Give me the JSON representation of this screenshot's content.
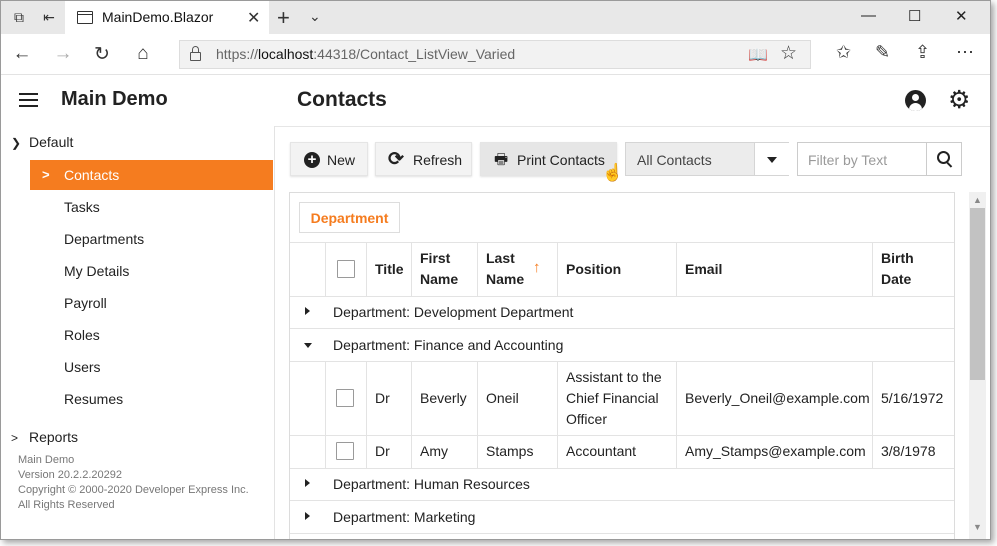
{
  "browser": {
    "tab_title": "MainDemo.Blazor",
    "tab_close": "✕",
    "new_tab": "+",
    "tab_menu": "⌄",
    "url_host_prefix": "https://",
    "url_host": "localhost",
    "url_rest": ":44318/Contact_ListView_Varied",
    "window_controls": {
      "minimize": "—",
      "maximize": "☐",
      "close": "✕"
    },
    "nav": {
      "back": "←",
      "forward": "→",
      "refresh": "↻",
      "home": "⌂"
    },
    "tools": {
      "favorites": "✩",
      "pen": "✎",
      "share": "⇪",
      "more": "⋯"
    }
  },
  "app": {
    "name": "Main Demo",
    "page_title": "Contacts",
    "icons": {
      "user": "user-icon",
      "settings": "gear-icon",
      "settings_glyph": "⚙"
    }
  },
  "sidebar": {
    "group_default": "Default",
    "group_reports": "Reports",
    "items": [
      {
        "label": "Contacts",
        "active": true
      },
      {
        "label": "Tasks"
      },
      {
        "label": "Departments"
      },
      {
        "label": "My Details"
      },
      {
        "label": "Payroll"
      },
      {
        "label": "Roles"
      },
      {
        "label": "Users"
      },
      {
        "label": "Resumes"
      }
    ],
    "footer": {
      "line1": "Main Demo",
      "line2": "Version 20.2.2.20292",
      "line3": "Copyright © 2000-2020 Developer Express Inc.",
      "line4": "All Rights Reserved"
    }
  },
  "toolbar": {
    "new_label": "New",
    "refresh_label": "Refresh",
    "print_label": "Print Contacts",
    "filter_select_value": "All Contacts",
    "search_placeholder": "Filter by Text"
  },
  "grid": {
    "group_tag": "Department",
    "columns": {
      "title": "Title",
      "first_name_1": "First",
      "first_name_2": "Name",
      "last_name_1": "Last",
      "last_name_2": "Name",
      "position": "Position",
      "email": "Email",
      "birth_1": "Birth",
      "birth_2": "Date"
    },
    "sort_indicator": "↑",
    "groups": [
      {
        "label": "Department: Development Department",
        "expanded": false
      },
      {
        "label": "Department: Finance and Accounting",
        "expanded": true
      },
      {
        "label": "Department: Human Resources",
        "expanded": false
      },
      {
        "label": "Department: Marketing",
        "expanded": false
      }
    ],
    "rows": [
      {
        "title": "Dr",
        "first": "Beverly",
        "last": "Oneil",
        "position_1": "Assistant to the",
        "position_2": "Chief Financial",
        "position_3": "Officer",
        "email": "Beverly_Oneil@example.com",
        "birth": "5/16/1972"
      },
      {
        "title": "Dr",
        "first": "Amy",
        "last": "Stamps",
        "position_1": "Accountant",
        "email": "Amy_Stamps@example.com",
        "birth": "3/8/1978"
      }
    ]
  },
  "colors": {
    "accent": "#f57c1f"
  }
}
